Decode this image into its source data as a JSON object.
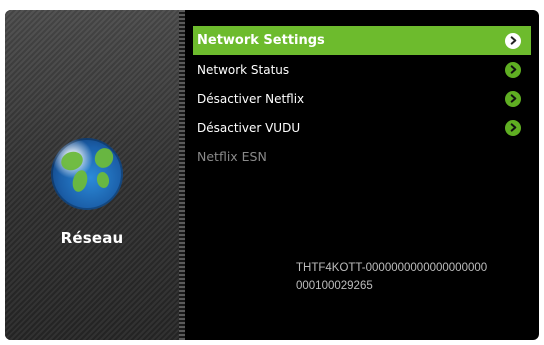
{
  "sidebar": {
    "section_label": "Réseau",
    "icon": "globe-icon"
  },
  "menu": {
    "items": [
      {
        "label": "Network Settings",
        "state": "selected",
        "icon": "chevron-right-icon"
      },
      {
        "label": "Network Status",
        "state": "normal",
        "icon": "chevron-right-icon"
      },
      {
        "label": "Désactiver Netflix",
        "state": "normal",
        "icon": "chevron-right-icon"
      },
      {
        "label": "Désactiver VUDU",
        "state": "normal",
        "icon": "chevron-right-icon"
      },
      {
        "label": "Netflix ESN",
        "state": "disabled"
      }
    ]
  },
  "esn": {
    "line1": "THTF4KOTT-0000000000000000000",
    "line2": "000100029265"
  },
  "colors": {
    "accent": "#6dbb2d",
    "background": "#000000",
    "disabled_text": "#8a8a8a"
  }
}
